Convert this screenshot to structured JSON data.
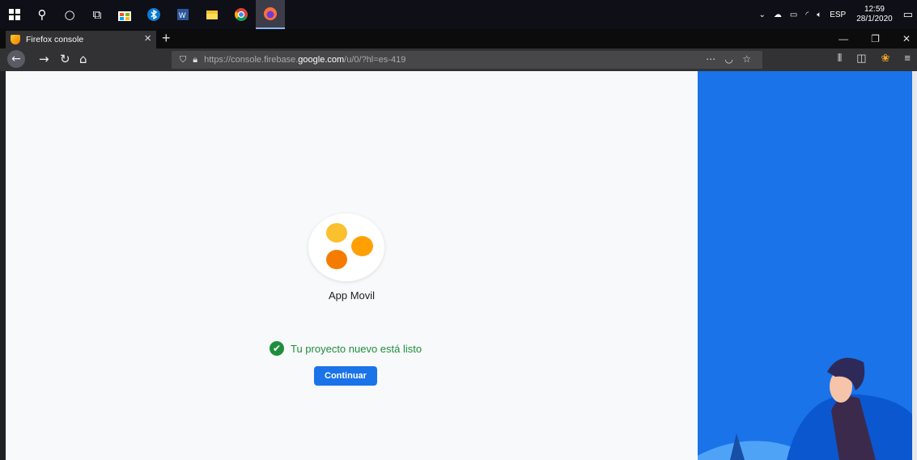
{
  "taskbar": {
    "tray_lang": "ESP",
    "clock_time": "12:59",
    "clock_date": "28/1/2020"
  },
  "browser": {
    "tab_title": "Firefox console",
    "url_prefix": "https://console.firebase.",
    "url_host": "google.com",
    "url_path": "/u/0/?hl=es-419"
  },
  "page": {
    "project_name": "App Movil",
    "status_text": "Tu proyecto nuevo está listo",
    "continue_label": "Continuar"
  },
  "colors": {
    "accent": "#1a73e8",
    "success": "#1e8e3e"
  }
}
